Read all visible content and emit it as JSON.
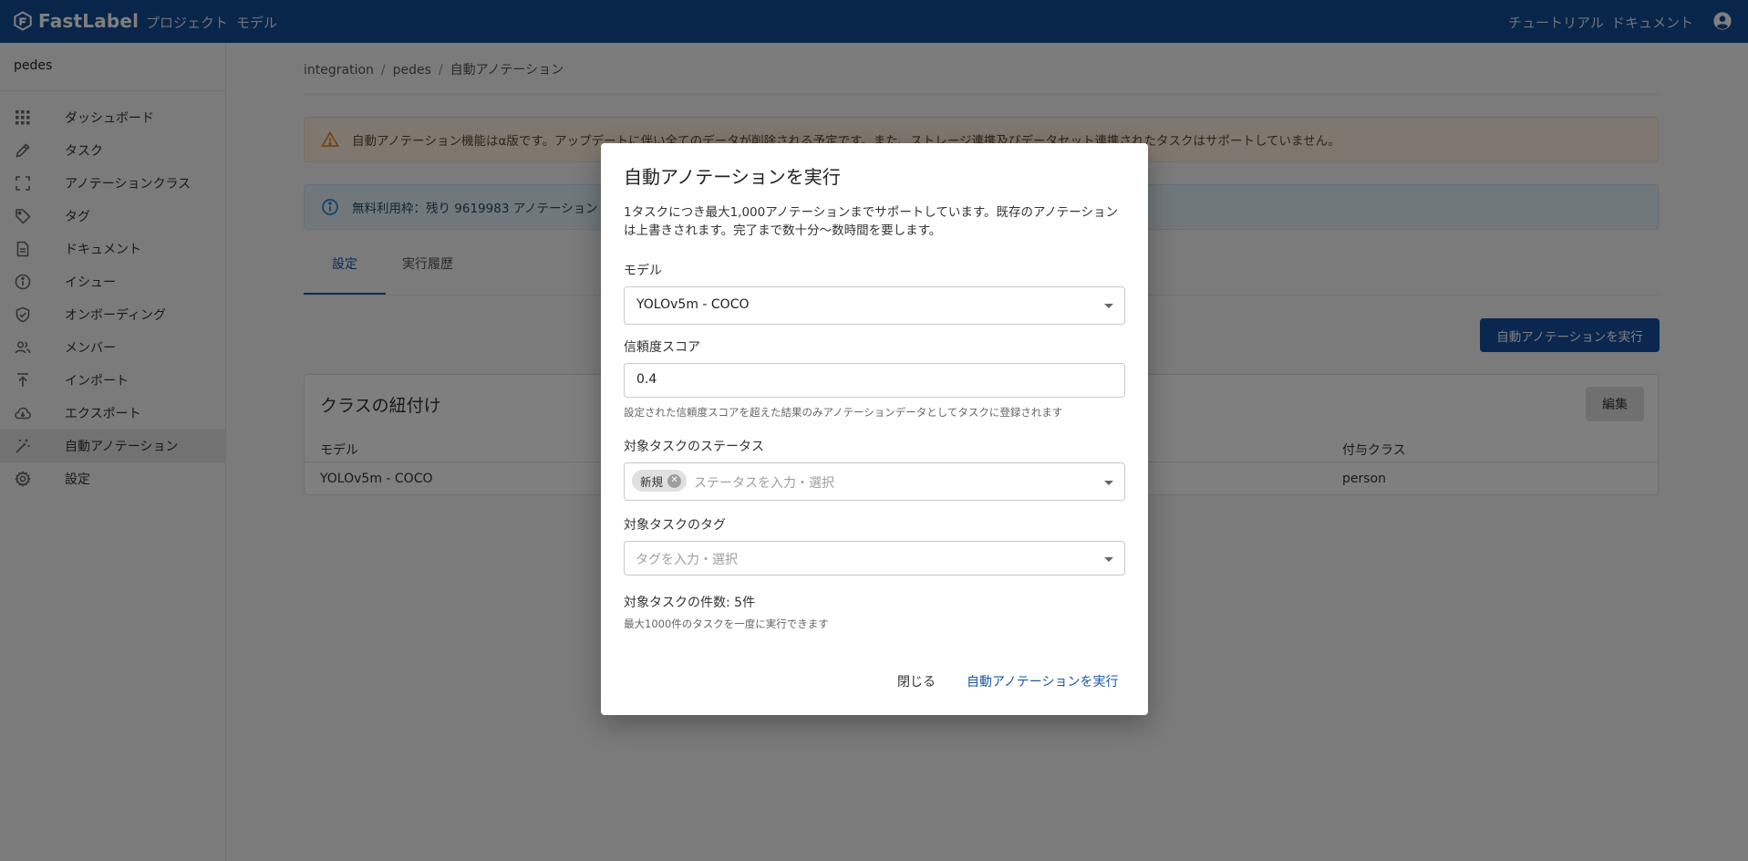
{
  "topbar": {
    "brand": "FastLabel",
    "nav_left": [
      "プロジェクト",
      "モデル"
    ],
    "nav_right": [
      "チュートリアル",
      "ドキュメント"
    ],
    "brand_color": "#114a94"
  },
  "sidebar": {
    "project": "pedes",
    "items": [
      {
        "label": "ダッシュボード",
        "icon": "grid-icon"
      },
      {
        "label": "タスク",
        "icon": "pencil-icon"
      },
      {
        "label": "アノテーションクラス",
        "icon": "frame-icon"
      },
      {
        "label": "タグ",
        "icon": "tag-icon"
      },
      {
        "label": "ドキュメント",
        "icon": "document-icon"
      },
      {
        "label": "イシュー",
        "icon": "info-icon"
      },
      {
        "label": "オンボーディング",
        "icon": "shield-check-icon"
      },
      {
        "label": "メンバー",
        "icon": "people-icon"
      },
      {
        "label": "インポート",
        "icon": "upload-icon"
      },
      {
        "label": "エクスポート",
        "icon": "cloud-download-icon"
      },
      {
        "label": "自動アノテーション",
        "icon": "magic-wand-icon",
        "active": true
      },
      {
        "label": "設定",
        "icon": "gear-icon"
      }
    ]
  },
  "main": {
    "breadcrumb": [
      "integration",
      "pedes",
      "自動アノテーション"
    ],
    "warning": "自動アノテーション機能はα版です。アップデートに伴い全てのデータが削除される予定です。また、ストレージ連携及びデータセット連携されたタスクはサポートしていません。",
    "info": "無料利用枠：残り 9619983 アノテーション",
    "tabs": [
      "設定",
      "実行履歴"
    ],
    "run_button": "自動アノテーションを実行",
    "card": {
      "title": "クラスの紐付け",
      "edit": "編集",
      "col_model": "モデル",
      "col_class": "付与クラス",
      "row_model": "YOLOv5m - COCO",
      "row_class": "person"
    }
  },
  "dialog": {
    "title": "自動アノテーションを実行",
    "description": "1タスクにつき最大1,000アノテーションまでサポートしています。既存のアノテーションは上書きされます。完了まで数十分〜数時間を要します。",
    "model_label": "モデル",
    "model_value": "YOLOv5m - COCO",
    "score_label": "信頼度スコア",
    "score_value": "0.4",
    "score_help": "設定された信頼度スコアを超えた結果のみアノテーションデータとしてタスクに登録されます",
    "status_label": "対象タスクのステータス",
    "status_chip": "新規",
    "status_placeholder": "ステータスを入力・選択",
    "tag_label": "対象タスクのタグ",
    "tag_placeholder": "タグを入力・選択",
    "count": "対象タスクの件数: 5件",
    "count_help": "最大1000件のタスクを一度に実行できます",
    "close": "閉じる",
    "run": "自動アノテーションを実行"
  }
}
